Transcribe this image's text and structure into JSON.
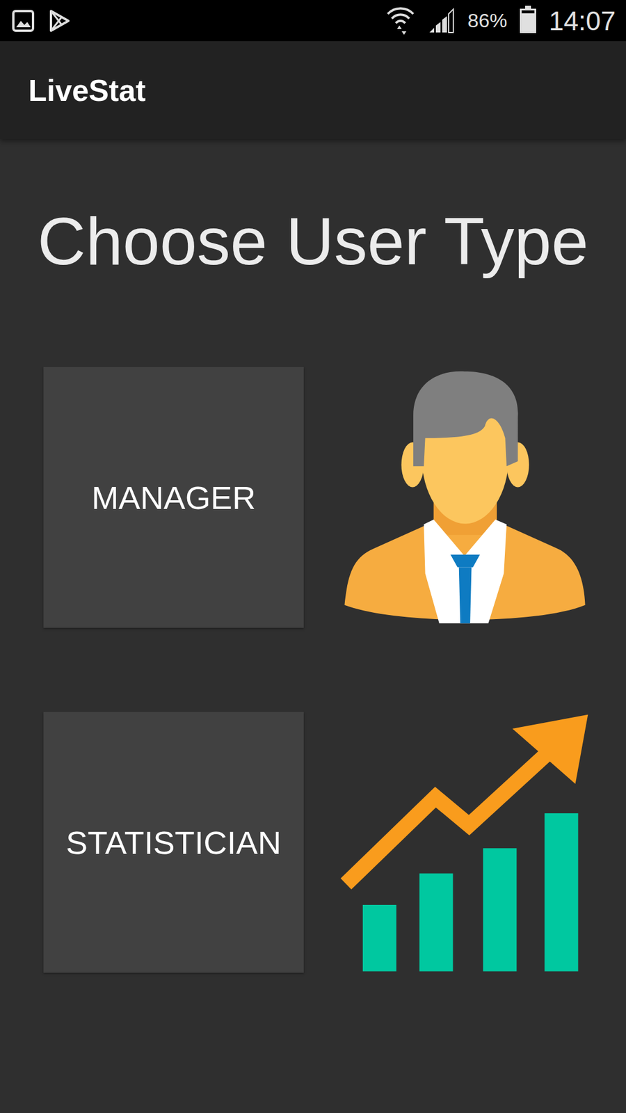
{
  "status_bar": {
    "battery": {
      "reading": "86%",
      "level": 0.86
    },
    "time": "14:07"
  },
  "app_bar": {
    "title": "LiveStat"
  },
  "heading": "Choose User Type",
  "options": [
    {
      "label": "MANAGER",
      "kind": "manager"
    },
    {
      "label": "STATISTICIAN",
      "kind": "statistician"
    }
  ]
}
